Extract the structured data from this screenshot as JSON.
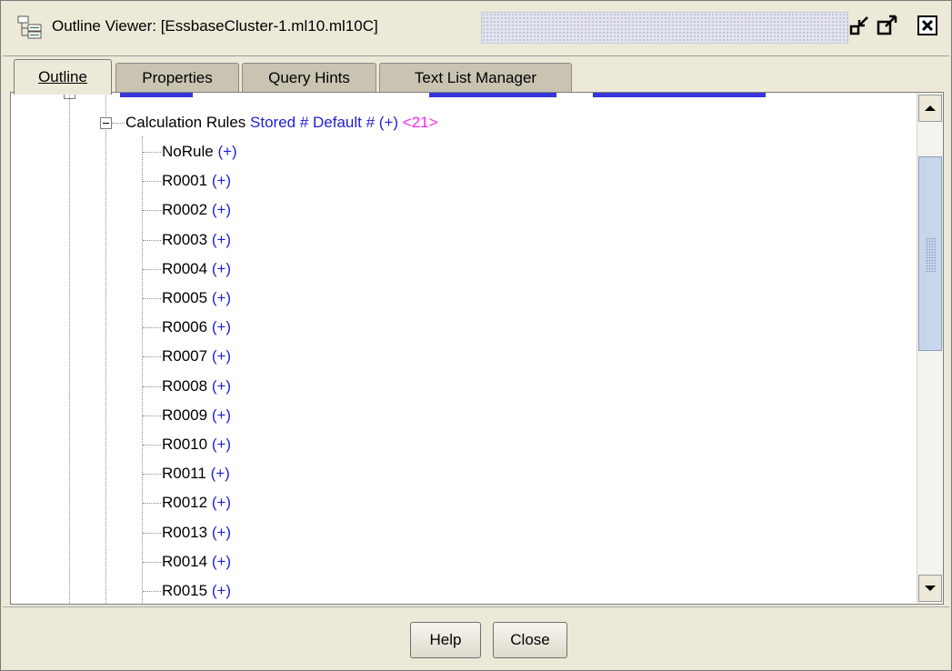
{
  "window": {
    "title": "Outline Viewer: [EssbaseCluster-1.ml10.ml10C]",
    "controls": [
      "restore-icon",
      "maximize-icon",
      "close-icon"
    ]
  },
  "tabs": [
    {
      "label": "Outline",
      "active": true
    },
    {
      "label": "Properties",
      "active": false
    },
    {
      "label": "Query Hints",
      "active": false
    },
    {
      "label": "Text List Manager",
      "active": false
    }
  ],
  "tree": {
    "parent": {
      "name": "Calculation Rules",
      "properties": "Stored # Default # (+)",
      "child_count": "<21>"
    },
    "children": [
      {
        "name": "NoRule",
        "op": "(+)"
      },
      {
        "name": "R0001",
        "op": "(+)"
      },
      {
        "name": "R0002",
        "op": "(+)"
      },
      {
        "name": "R0003",
        "op": "(+)"
      },
      {
        "name": "R0004",
        "op": "(+)"
      },
      {
        "name": "R0005",
        "op": "(+)"
      },
      {
        "name": "R0006",
        "op": "(+)"
      },
      {
        "name": "R0007",
        "op": "(+)"
      },
      {
        "name": "R0008",
        "op": "(+)"
      },
      {
        "name": "R0009",
        "op": "(+)"
      },
      {
        "name": "R0010",
        "op": "(+)"
      },
      {
        "name": "R0011",
        "op": "(+)"
      },
      {
        "name": "R0012",
        "op": "(+)"
      },
      {
        "name": "R0013",
        "op": "(+)"
      },
      {
        "name": "R0014",
        "op": "(+)"
      },
      {
        "name": "R0015",
        "op": "(+)"
      }
    ]
  },
  "buttons": {
    "help": "Help",
    "close": "Close"
  },
  "colors": {
    "member_property_blue": "#1f1fd6",
    "child_count_magenta": "#ff22ee",
    "window_bg": "#ece9d8"
  }
}
